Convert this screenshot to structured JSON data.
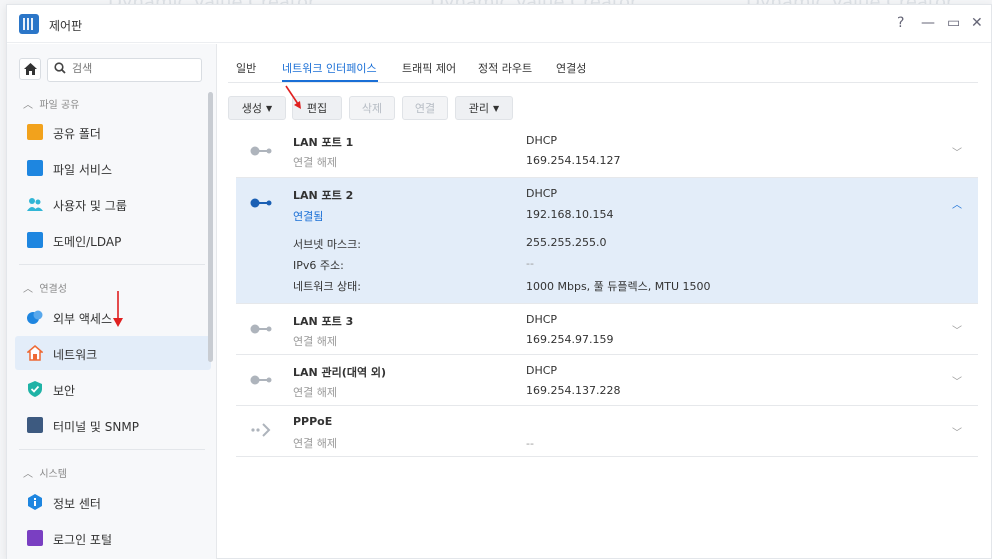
{
  "background_text": [
    "Dynamic Value Creator",
    "Dynamic Value Creator",
    "Dynamic Value Creator"
  ],
  "window": {
    "title": "제어판",
    "controls": [
      "?",
      "—",
      "▭",
      "✕"
    ]
  },
  "sidebar": {
    "search_placeholder": "검색",
    "sections": [
      {
        "label": "파일 공유",
        "items": [
          {
            "label": "공유 폴더",
            "icon": "folder-icon",
            "color": "#f2a21c"
          },
          {
            "label": "파일 서비스",
            "icon": "file-services-icon",
            "color": "#1e86e0"
          },
          {
            "label": "사용자 및 그룹",
            "icon": "users-icon",
            "color": "#31b6d6"
          },
          {
            "label": "도메인/LDAP",
            "icon": "domain-icon",
            "color": "#1e86e0"
          }
        ]
      },
      {
        "label": "연결성",
        "items": [
          {
            "label": "외부 액세스",
            "icon": "external-access-icon",
            "color": "#1e86e0"
          },
          {
            "label": "네트워크",
            "icon": "network-house-icon",
            "color": "#ee6a35"
          },
          {
            "label": "보안",
            "icon": "shield-icon",
            "color": "#1fb3a6"
          },
          {
            "label": "터미널 및 SNMP",
            "icon": "terminal-icon",
            "color": "#3d5a80"
          }
        ]
      },
      {
        "label": "시스템",
        "items": [
          {
            "label": "정보 센터",
            "icon": "info-icon",
            "color": "#1e86e0"
          },
          {
            "label": "로그인 포털",
            "icon": "login-portal-icon",
            "color": "#7a3fc2"
          }
        ]
      }
    ]
  },
  "tabs": [
    "일반",
    "네트워크 인터페이스",
    "트래픽 제어",
    "정적 라우트",
    "연결성"
  ],
  "toolbar": {
    "create": "생성",
    "edit": "편집",
    "delete": "삭제",
    "connect": "연결",
    "manage": "관리"
  },
  "interfaces": [
    {
      "name": "LAN 포트 1",
      "status": "연결 해제",
      "protocol": "DHCP",
      "ip": "169.254.154.127"
    },
    {
      "name": "LAN 포트 2",
      "status": "연결됨",
      "protocol": "DHCP",
      "ip": "192.168.10.154",
      "details": [
        {
          "label": "서브넷 마스크:",
          "value": "255.255.255.0"
        },
        {
          "label": "IPv6 주소:",
          "value": "--"
        },
        {
          "label": "네트워크 상태:",
          "value": "1000 Mbps, 풀 듀플렉스, MTU 1500"
        }
      ]
    },
    {
      "name": "LAN 포트 3",
      "status": "연결 해제",
      "protocol": "DHCP",
      "ip": "169.254.97.159"
    },
    {
      "name": "LAN 관리(대역 외)",
      "status": "연결 해제",
      "protocol": "DHCP",
      "ip": "169.254.137.228"
    },
    {
      "name": "PPPoE",
      "status": "연결 해제",
      "protocol": "",
      "ip": "--"
    }
  ],
  "accent_color": "#1a6fd6",
  "annotation_color": "#e02020"
}
